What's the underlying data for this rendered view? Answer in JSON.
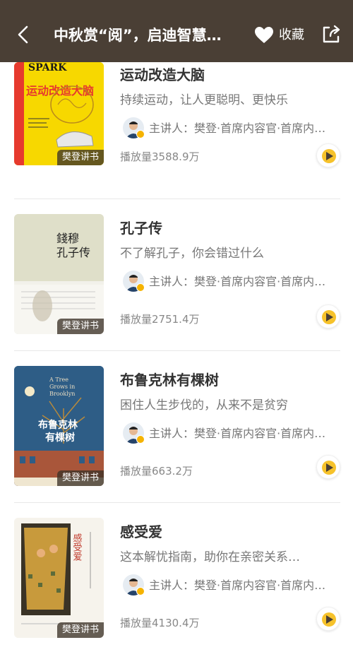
{
  "header": {
    "title": "中秋赏“阅”，启迪智慧…",
    "favorite_label": "收藏",
    "icons": [
      "back-arrow-icon",
      "heart-icon",
      "share-icon"
    ],
    "bg_color": "#4a3f35"
  },
  "tag_label": "樊登讲书",
  "accent_color": "#f6c22b",
  "books": [
    {
      "title": "运动改造大脑",
      "desc": "持续运动，让人更聪明、更快乐",
      "speaker": "主讲人：樊登·首席内容官·首席内…",
      "plays": "播放量3588.9万",
      "cover": {
        "text": "运动改造大脑",
        "subtext": "SPARK",
        "bg": "#f7d800"
      }
    },
    {
      "title": "孔子传",
      "desc": "不了解孔子，你会错过什么",
      "speaker": "主讲人：樊登·首席内容官·首席内…",
      "plays": "播放量2751.4万",
      "cover": {
        "text": "孔子传",
        "subtext": "錢穆",
        "bg": "#e4e2d3"
      }
    },
    {
      "title": "布鲁克林有棵树",
      "desc": "困住人生步伐的，从来不是贫穷",
      "speaker": "主讲人：樊登·首席内容官·首席内…",
      "plays": "播放量663.2万",
      "cover": {
        "text": "布鲁克林\n有棵树",
        "subtext": "A Tree Grows in Brooklyn",
        "bg": "#2e5d86"
      }
    },
    {
      "title": "感受爱",
      "desc": "这本解忧指南，助你在亲密关系…",
      "speaker": "主讲人：樊登·首席内容官·首席内…",
      "plays": "播放量4130.4万",
      "cover": {
        "text": "感受爱",
        "subtext": "",
        "bg": "#f4f1ea"
      }
    }
  ]
}
